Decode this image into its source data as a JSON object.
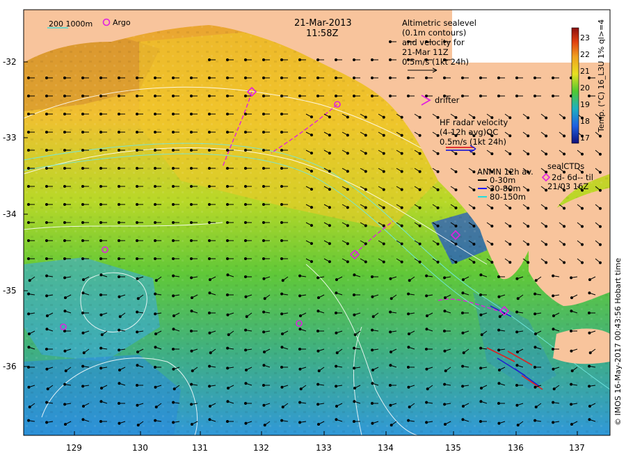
{
  "header": {
    "date": "21-Mar-2013",
    "time": "11:58Z"
  },
  "legend_left": {
    "depths": "200  1000m",
    "argo": "Argo"
  },
  "altimetry": {
    "lines": [
      "Altimetric sealevel",
      "(0.1m contours)",
      "and velocity for",
      "21-Mar 11Z",
      "0.5m/s (1kt 24h)"
    ]
  },
  "drifter": {
    "label": "drifter"
  },
  "hf_radar": {
    "lines": [
      "HF radar velocity",
      "(4-12h avg)QC",
      "0.5m/s (1kt 24h)"
    ]
  },
  "anmn": {
    "title": "ANMN 12h av.",
    "items": [
      {
        "label": "0-30m",
        "color": "#000000"
      },
      {
        "label": "30-80m",
        "color": "#1a1aff"
      },
      {
        "label": "80-150m",
        "color": "#22dddd"
      }
    ]
  },
  "sealctd": {
    "lines": [
      "sealCTDs",
      "2d- 6d-- til",
      "21/03 16Z"
    ]
  },
  "colorbar": {
    "label": "Temp. (°C) 16_L3U 1% ql>=4",
    "ticks": [
      "23",
      "22",
      "21",
      "20",
      "19",
      "18",
      "17"
    ]
  },
  "credit": "© IMOS 16-May-2017 00:43:56 Hobart time",
  "axes": {
    "lat_ticks": [
      "-32",
      "-33",
      "-34",
      "-35",
      "-36"
    ],
    "lon_ticks": [
      "129",
      "130",
      "131",
      "132",
      "133",
      "134",
      "135",
      "136",
      "137"
    ]
  },
  "colors": {
    "land": "#f8c49c",
    "warm": "#f0a020",
    "cool": "#3aa8e8",
    "argo": "#e020e0"
  }
}
